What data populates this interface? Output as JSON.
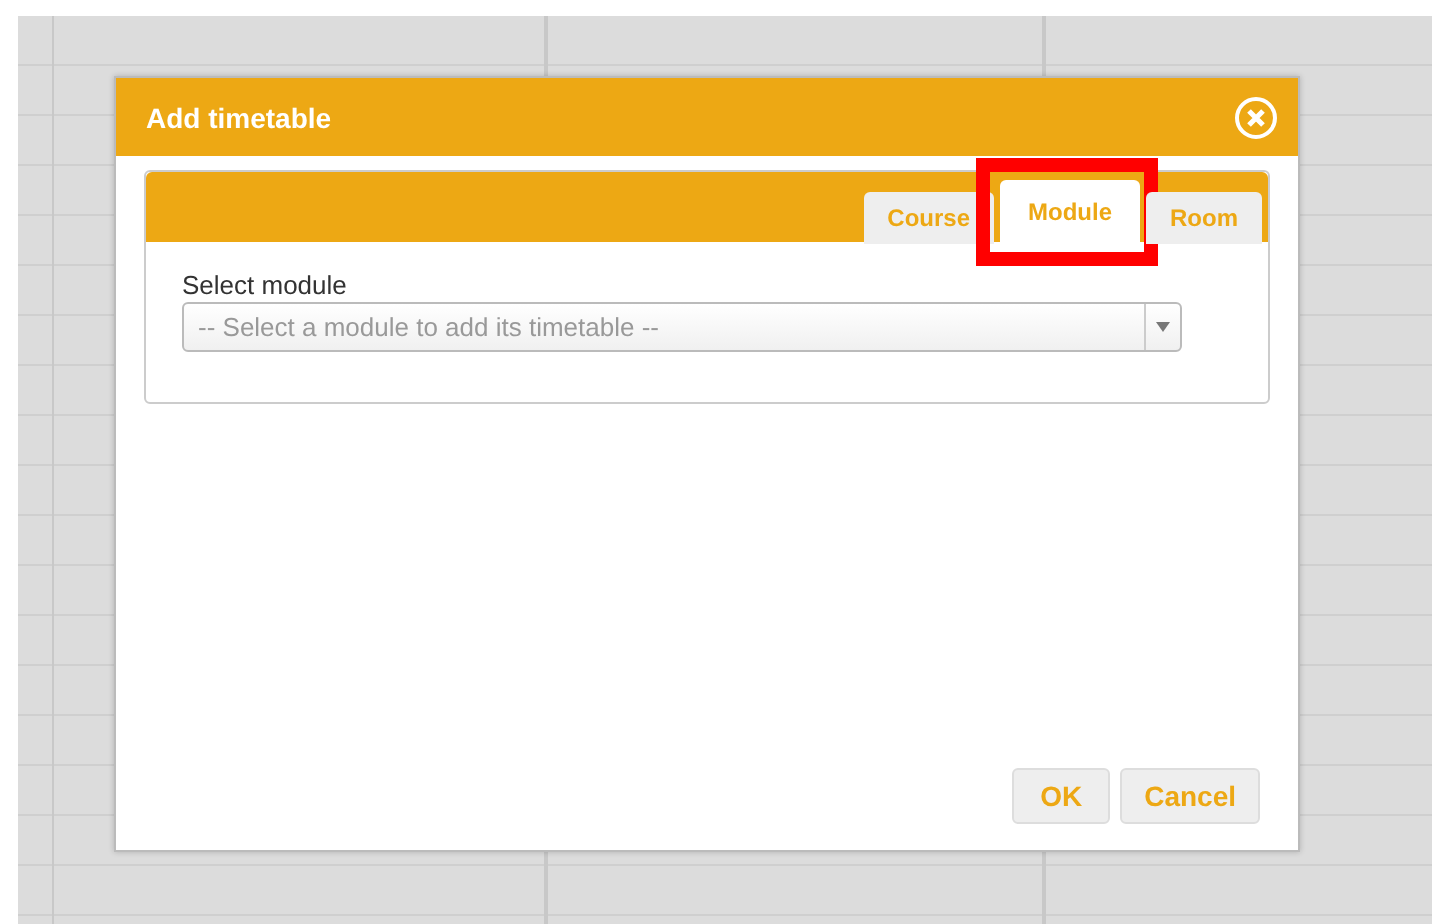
{
  "dialog": {
    "title": "Add timetable",
    "tabs": [
      {
        "label": "Course",
        "selected": false,
        "highlighted": false
      },
      {
        "label": "Module",
        "selected": true,
        "highlighted": true
      },
      {
        "label": "Room",
        "selected": false,
        "highlighted": false
      }
    ],
    "field": {
      "label": "Select module",
      "placeholder": "-- Select a module to add its timetable --"
    },
    "buttons": [
      "OK",
      "Cancel"
    ]
  }
}
